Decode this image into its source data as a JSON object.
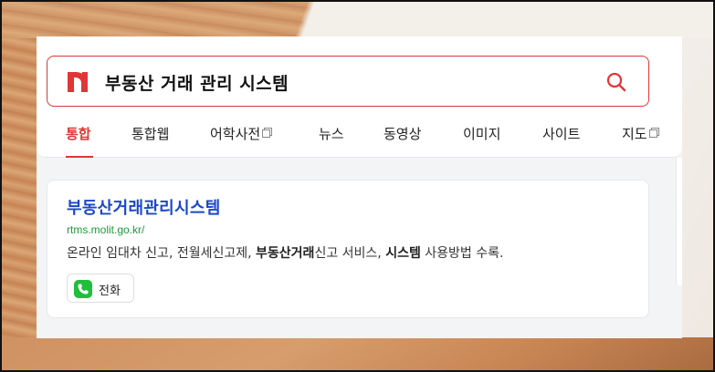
{
  "search": {
    "query": "부동산 거래 관리 시스템",
    "logo": "naver-n-logo",
    "search_icon": "search-icon",
    "accent_color": "#e03636"
  },
  "tabs": [
    {
      "label": "통합",
      "active": true,
      "external": false
    },
    {
      "label": "통합웹",
      "active": false,
      "external": false
    },
    {
      "label": "어학사전",
      "active": false,
      "external": true
    },
    {
      "label": "뉴스",
      "active": false,
      "external": false
    },
    {
      "label": "동영상",
      "active": false,
      "external": false
    },
    {
      "label": "이미지",
      "active": false,
      "external": false
    },
    {
      "label": "사이트",
      "active": false,
      "external": false
    },
    {
      "label": "지도",
      "active": false,
      "external": true
    }
  ],
  "result": {
    "title": "부동산거래관리시스템",
    "url": "rtms.molit.go.kr/",
    "desc": {
      "part1": "온라인 임대차 신고, 전월세신고제, ",
      "bold1": "부동산거래",
      "part2": "신고 서비스, ",
      "bold2": "시스템",
      "part3": " 사용방법 수록."
    },
    "phone_label": "전화",
    "phone_icon": "phone-icon"
  },
  "colors": {
    "title_link": "#1a48c9",
    "url": "#1b9a3a",
    "phone_green": "#1fbf3a"
  }
}
